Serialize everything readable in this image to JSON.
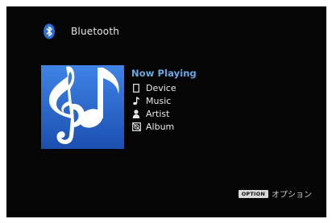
{
  "header": {
    "source_label": "Bluetooth",
    "icon": "bluetooth-icon"
  },
  "now_playing": {
    "title": "Now Playing",
    "items": [
      {
        "label": "Device",
        "icon": "device-icon"
      },
      {
        "label": "Music",
        "icon": "music-note-icon"
      },
      {
        "label": "Artist",
        "icon": "artist-icon"
      },
      {
        "label": "Album",
        "icon": "album-icon"
      }
    ]
  },
  "album_art": {
    "icon": "music-notes-icon"
  },
  "footer": {
    "option_button": "OPTION",
    "option_text": "オプション"
  },
  "colors": {
    "background": "#050505",
    "accent": "#69a9e6",
    "art_blue": "#2a63c9"
  }
}
